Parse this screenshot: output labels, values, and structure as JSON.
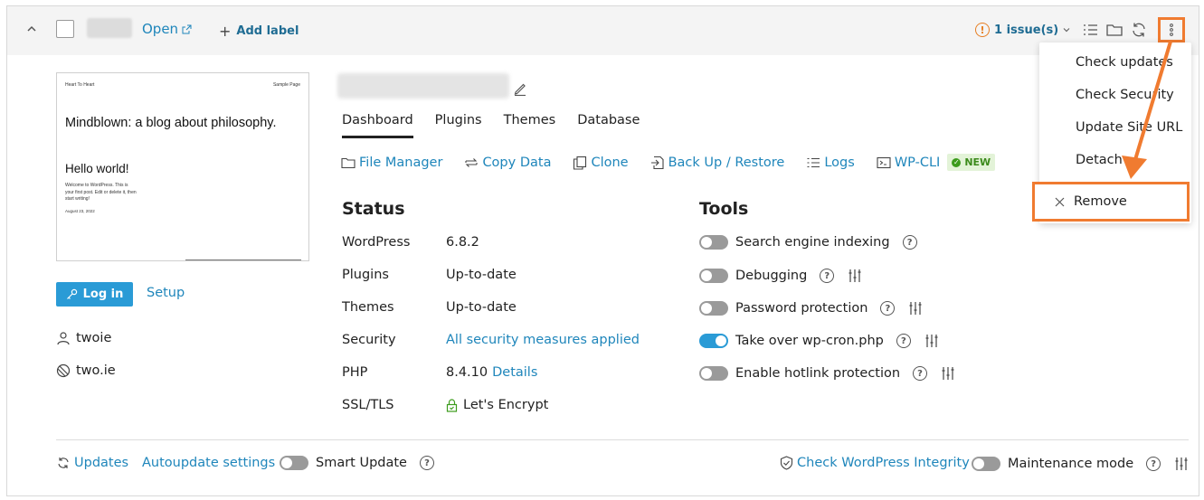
{
  "header": {
    "open_label": "Open",
    "add_label": "Add label",
    "issues_label": "1 issue(s)"
  },
  "preview": {
    "site_name": "Heart To Heart",
    "sample_page": "Sample Page",
    "tagline": "Mindblown: a blog about philosophy.",
    "post_title": "Hello world!",
    "post_excerpt": "Welcome to WordPress. This is your first post. Edit or delete it, then start writing!",
    "post_date": "August 23, 2022"
  },
  "sidebar": {
    "login_label": "Log in",
    "setup_label": "Setup",
    "user": "twoie",
    "domain": "two.ie"
  },
  "tabs": [
    "Dashboard",
    "Plugins",
    "Themes",
    "Database"
  ],
  "actions": {
    "file_manager": "File Manager",
    "copy_data": "Copy Data",
    "clone": "Clone",
    "backup": "Back Up / Restore",
    "logs": "Logs",
    "wpcli": "WP-CLI",
    "new_badge": "NEW"
  },
  "status": {
    "title": "Status",
    "rows": [
      {
        "label": "WordPress",
        "value": "6.8.2"
      },
      {
        "label": "Plugins",
        "value": "Up-to-date"
      },
      {
        "label": "Themes",
        "value": "Up-to-date"
      },
      {
        "label": "Security",
        "value": "All security measures applied"
      },
      {
        "label": "PHP",
        "value": "8.4.10",
        "link": "Details"
      },
      {
        "label": "SSL/TLS",
        "value": "Let's Encrypt"
      }
    ]
  },
  "tools": {
    "title": "Tools",
    "rows": [
      {
        "label": "Search engine indexing",
        "on": false
      },
      {
        "label": "Debugging",
        "on": false
      },
      {
        "label": "Password protection",
        "on": false
      },
      {
        "label": "Take over wp-cron.php",
        "on": true
      },
      {
        "label": "Enable hotlink protection",
        "on": false
      }
    ]
  },
  "footer": {
    "updates": "Updates",
    "autoupdate": "Autoupdate settings",
    "smart_update": "Smart Update",
    "integrity": "Check WordPress Integrity",
    "maintenance": "Maintenance mode"
  },
  "menu": {
    "items": [
      "Check updates",
      "Check Security",
      "Update Site URL",
      "Detach"
    ],
    "remove": "Remove"
  },
  "colors": {
    "link": "#1f86bb",
    "primary_button": "#2a9bd6",
    "highlight": "#f07b30",
    "warning": "#e67e22",
    "new_badge_bg": "#e3f3d8"
  }
}
